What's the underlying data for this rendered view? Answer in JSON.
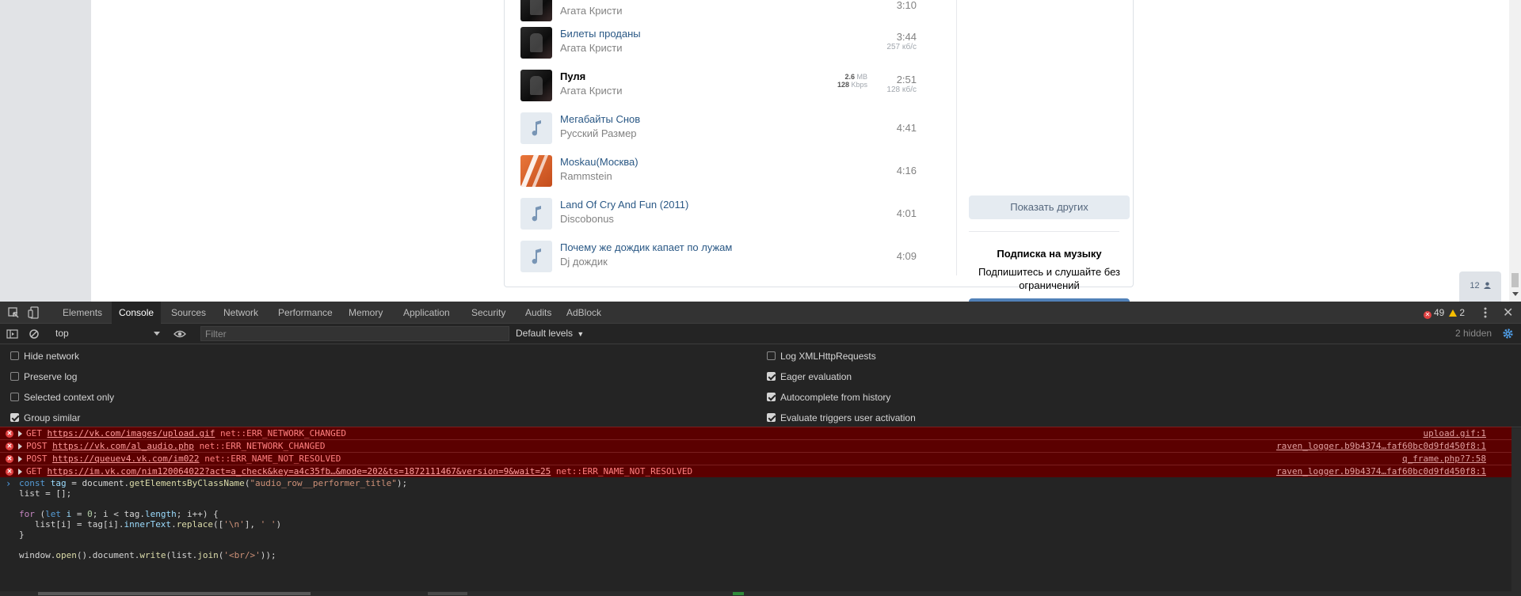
{
  "tracks": [
    {
      "title": "",
      "artist": "Агата Кристи",
      "duration": "3:10",
      "cover": "dark"
    },
    {
      "title": "Билеты проданы",
      "artist": "Агата Кристи",
      "duration": "3:44",
      "speed": "257 кб/с",
      "cover": "dark"
    },
    {
      "title": "Пуля",
      "artist": "Агата Кристи",
      "duration": "2:51",
      "speed": "128 кб/с",
      "size_mb": "2.6",
      "size_unit": "MB",
      "bitrate": "128",
      "bitrate_unit": "Kbps",
      "cover": "dark",
      "playing": true
    },
    {
      "title": "Мегабайты Снов",
      "artist": "Русский Размер",
      "duration": "4:41",
      "cover": "note"
    },
    {
      "title": "Moskau(Москва)",
      "artist": "Rammstein",
      "duration": "4:16",
      "cover": "orange"
    },
    {
      "title": "Land Of Cry And Fun (2011)",
      "artist": "Discobonus",
      "duration": "4:01",
      "cover": "note"
    },
    {
      "title": "Почему же дождик капает по лужам",
      "artist": "Dj дождик",
      "duration": "4:09",
      "cover": "note"
    }
  ],
  "sidebar": {
    "show_more": "Показать других",
    "subscription_title": "Подписка на музыку",
    "subscription_text_1": "Подпишитесь и слушайте без",
    "subscription_text_2": "ограничений"
  },
  "badge": {
    "count": "12"
  },
  "devtools": {
    "tabs": [
      "Elements",
      "Console",
      "Sources",
      "Network",
      "Performance",
      "Memory",
      "Application",
      "Security",
      "Audits",
      "AdBlock"
    ],
    "active_tab": "Console",
    "errors": "49",
    "warnings": "2",
    "context": "top",
    "filter_placeholder": "Filter",
    "levels": "Default levels",
    "hidden": "2 hidden",
    "settings_left": [
      {
        "label": "Hide network",
        "checked": false
      },
      {
        "label": "Preserve log",
        "checked": false
      },
      {
        "label": "Selected context only",
        "checked": false
      },
      {
        "label": "Group similar",
        "checked": true
      }
    ],
    "settings_right": [
      {
        "label": "Log XMLHttpRequests",
        "checked": false
      },
      {
        "label": "Eager evaluation",
        "checked": true
      },
      {
        "label": "Autocomplete from history",
        "checked": true
      },
      {
        "label": "Evaluate triggers user activation",
        "checked": true
      }
    ],
    "messages": [
      {
        "method": "GET",
        "url": "https://vk.com/images/upload.gif",
        "error": "net::ERR_NETWORK_CHANGED",
        "source": "upload.gif:1"
      },
      {
        "method": "POST",
        "url": "https://vk.com/al_audio.php",
        "error": "net::ERR_NETWORK_CHANGED",
        "source": "raven_logger.b9b4374…faf60bc0d9fd450f8:1"
      },
      {
        "method": "POST",
        "url": "https://queuev4.vk.com/im022",
        "error": "net::ERR_NAME_NOT_RESOLVED",
        "source": "q_frame.php?7:58"
      },
      {
        "method": "GET",
        "url": "https://im.vk.com/nim120064022?act=a_check&key=a4c35fb…&mode=202&ts=1872111467&version=9&wait=25",
        "error": "net::ERR_NAME_NOT_RESOLVED",
        "source": "raven_logger.b9b4374…faf60bc0d9fd450f8:1"
      }
    ]
  },
  "colors": {
    "vk_link": "#2a5885",
    "vk_button": "#5181b8",
    "devtools_bg": "#242424",
    "error_bg": "#5b0000",
    "error_text": "#ff8080"
  }
}
